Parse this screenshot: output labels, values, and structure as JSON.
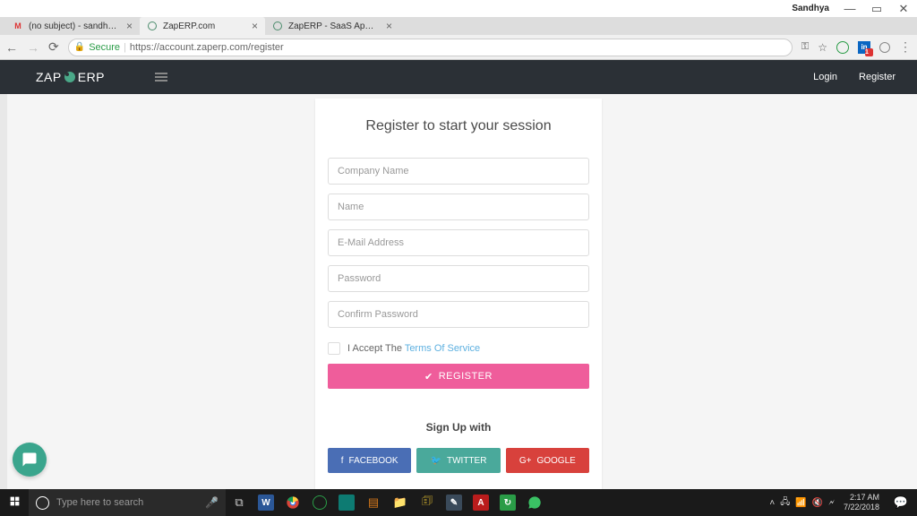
{
  "window": {
    "user": "Sandhya"
  },
  "tabs": [
    {
      "title": "(no subject) - sandhya.sn"
    },
    {
      "title": "ZapERP.com"
    },
    {
      "title": "ZapERP - SaaS Applicatio"
    }
  ],
  "address_bar": {
    "secure_label": "Secure",
    "url": "https://account.zaperp.com/register"
  },
  "header": {
    "logo_left": "ZAP",
    "logo_right": "ERP",
    "nav_login": "Login",
    "nav_register": "Register"
  },
  "form": {
    "title": "Register to start your session",
    "placeholders": {
      "company": "Company Name",
      "name": "Name",
      "email": "E-Mail Address",
      "password": "Password",
      "confirm": "Confirm Password"
    },
    "accept_prefix": "I Accept The ",
    "tos": "Terms Of Service",
    "register_btn": "REGISTER",
    "signup_with": "Sign Up with",
    "social": {
      "facebook": "FACEBOOK",
      "twitter": "TWITTER",
      "google": "GOOGLE"
    }
  },
  "taskbar": {
    "search_placeholder": "Type here to search",
    "time": "2:17 AM",
    "date": "7/22/2018"
  }
}
